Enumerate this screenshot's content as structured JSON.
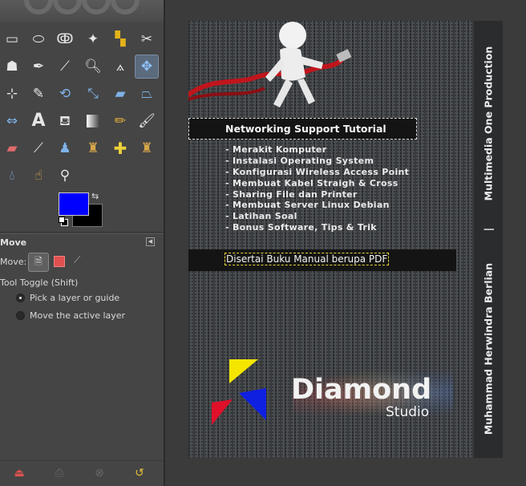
{
  "toolbox": {
    "tool_icons": [
      "rect-select-icon",
      "ellipse-select-icon",
      "free-select-icon",
      "fuzzy-select-icon",
      "color-select-icon",
      "scissors-select-icon",
      "foreground-select-icon",
      "paths-icon",
      "color-picker-icon",
      "zoom-icon",
      "measure-icon",
      "move-icon",
      "align-icon",
      "crop-icon",
      "rotate-icon",
      "scale-icon",
      "shear-icon",
      "perspective-icon",
      "flip-icon",
      "text-icon",
      "bucket-fill-icon",
      "blend-icon",
      "pencil-icon",
      "paintbrush-icon",
      "eraser-icon",
      "airbrush-icon",
      "ink-icon",
      "clone-icon",
      "heal-icon",
      "perspective-clone-icon",
      "blur-icon",
      "smudge-icon",
      "dodge-burn-icon"
    ],
    "foreground_color": "#0000ff",
    "background_color": "#000000",
    "options_title": "Move",
    "move_label": "Move:",
    "tool_toggle_label": "Tool Toggle  (Shift)",
    "radio_options": [
      {
        "label": "Pick a layer or guide",
        "checked": true
      },
      {
        "label": "Move the active layer",
        "checked": false
      }
    ]
  },
  "cover": {
    "title_box": "Networking Support Tutorial",
    "items": [
      "- Merakit Komputer",
      "- Instalasi Operating System",
      "- Konfigurasi Wireless Access Point",
      "- Membuat Kabel Straigh & Cross",
      "- Sharing File dan Printer",
      "- Membuat Server Linux Debian",
      "- Latihan Soal",
      "- Bonus Software, Tips & Trik"
    ],
    "manual_note": "Disertai Buku Manual berupa PDF",
    "brand_name": "Diamond",
    "brand_sub": "Studio",
    "side_text_top": "Multimedia One Production",
    "side_divider": "|",
    "side_text_bottom": "Muhammad Herwindra Berlian",
    "logo_colors": {
      "yellow": "#f5e600",
      "red": "#e0102a",
      "blue": "#1020e0"
    },
    "cable_color": "#c0151c"
  }
}
